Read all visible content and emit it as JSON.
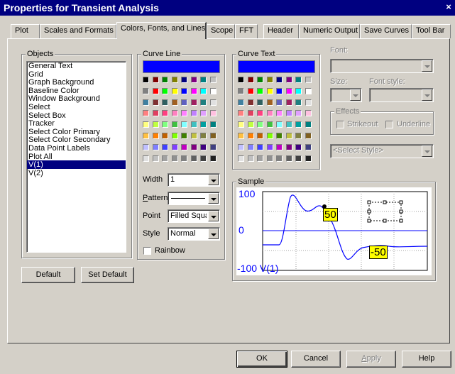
{
  "window": {
    "title": "Properties for Transient Analysis",
    "close_glyph": "×"
  },
  "tabs": [
    {
      "label": "Plot"
    },
    {
      "label": "Scales and Formats"
    },
    {
      "label": "Colors, Fonts, and Lines",
      "active": true
    },
    {
      "label": "Scope"
    },
    {
      "label": "FFT"
    },
    {
      "label": "Header"
    },
    {
      "label": "Numeric Output"
    },
    {
      "label": "Save Curves"
    },
    {
      "label": "Tool Bar"
    }
  ],
  "objects": {
    "label": "Objects",
    "items": [
      "General Text",
      "Grid",
      "Graph Background",
      "Baseline Color",
      "Window Background",
      "Select",
      "Select Box",
      "Tracker",
      "Select Color Primary",
      "Select Color Secondary",
      "Data Point Labels",
      "Plot All",
      "V(1)",
      "V(2)"
    ],
    "selected": "V(1)"
  },
  "curve_line": {
    "label": "Curve Line",
    "current_color": "#0000ff",
    "width_label": "Width",
    "width_value": "1",
    "pattern_label": "Pattern",
    "point_label": "Point",
    "point_value": "Filled Squa",
    "style_label": "Style",
    "style_value": "Normal",
    "rainbow_label": "Rainbow"
  },
  "curve_text": {
    "label": "Curve Text",
    "current_color": "#0000ff"
  },
  "palette": [
    [
      "#000000",
      "#800000",
      "#008000",
      "#808000",
      "#000080",
      "#800080",
      "#008080",
      "#c0c0c0"
    ],
    [
      "#808080",
      "#ff0000",
      "#00ff00",
      "#ffff00",
      "#0000ff",
      "#ff00ff",
      "#00ffff",
      "#ffffff"
    ],
    [
      "#4080a0",
      "#803030",
      "#306060",
      "#a06020",
      "#6060c0",
      "#a02060",
      "#208080",
      "#e0e0e0"
    ],
    [
      "#ff8080",
      "#e04060",
      "#ff4080",
      "#ff80c0",
      "#ff80ff",
      "#c080ff",
      "#e0a0ff",
      "#ffc0e0"
    ],
    [
      "#ffff80",
      "#c0ff40",
      "#80ff80",
      "#40c040",
      "#80ffff",
      "#40c0c0",
      "#00a0a0",
      "#008080"
    ],
    [
      "#ffc040",
      "#ff8000",
      "#c06000",
      "#80ff00",
      "#408000",
      "#c0c040",
      "#808040",
      "#806020"
    ],
    [
      "#c0c0ff",
      "#8080ff",
      "#4040ff",
      "#8040ff",
      "#c000c0",
      "#800080",
      "#400080",
      "#404080"
    ],
    [
      "#e0e0e0",
      "#c0c0c0",
      "#a0a0a0",
      "#909090",
      "#808080",
      "#606060",
      "#404040",
      "#202020"
    ]
  ],
  "font": {
    "font_label": "Font:",
    "size_label": "Size:",
    "style_label": "Font style:",
    "effects_label": "Effects",
    "strikeout_label": "Strikeout",
    "underline_label": "Underline",
    "select_style": "<Select Style>"
  },
  "sample": {
    "label": "Sample",
    "y_top": "100",
    "y_mid": "0",
    "y_bottom": "-100",
    "trace_name": "V(1)",
    "tag_high": "50",
    "tag_low": "-50",
    "trace_color": "#0000ff",
    "label_bg": "#ffff00"
  },
  "buttons": {
    "default": "Default",
    "set_default": "Set Default",
    "ok": "OK",
    "cancel": "Cancel",
    "apply": "Apply",
    "help": "Help"
  }
}
